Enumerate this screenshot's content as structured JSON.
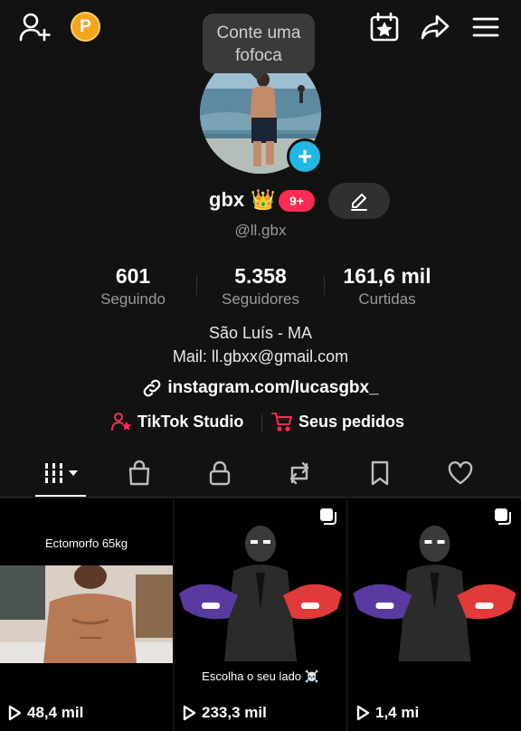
{
  "topbar": {
    "add_friend_icon": "person-add-icon",
    "coin_letter": "P",
    "calendar_icon": "calendar-star-icon",
    "share_icon": "share-arrow-icon",
    "menu_icon": "hamburger-menu-icon"
  },
  "tooltip": {
    "text_line1": "Conte uma",
    "text_line2": "fofoca"
  },
  "profile": {
    "name": "gbx",
    "crown": "👑",
    "badge": "9+",
    "handle": "@ll.gbx"
  },
  "stats": [
    {
      "value": "601",
      "label": "Seguindo"
    },
    {
      "value": "5.358",
      "label": "Seguidores"
    },
    {
      "value": "161,6 mil",
      "label": "Curtidas"
    }
  ],
  "bio": {
    "line1": "São Luís - MA",
    "line2": "Mail: ll.gbxx@gmail.com"
  },
  "link": "instagram.com/lucasgbx_",
  "actions": {
    "studio": "TikTok Studio",
    "orders": "Seus pedidos"
  },
  "tabs": [
    "videos-grid",
    "shop",
    "private",
    "reposts",
    "saved",
    "liked"
  ],
  "videos": [
    {
      "caption": "Ectomorfo 65kg",
      "views": "48,4 mil"
    },
    {
      "caption": "Escolha o seu lado ☠️",
      "views": "233,3 mil"
    },
    {
      "caption": "",
      "views": "1,4 mi"
    }
  ],
  "colors": {
    "background": "#121212",
    "accent_pink": "#fe2c55",
    "accent_blue": "#21b8e3",
    "coin": "#f4a51d"
  }
}
